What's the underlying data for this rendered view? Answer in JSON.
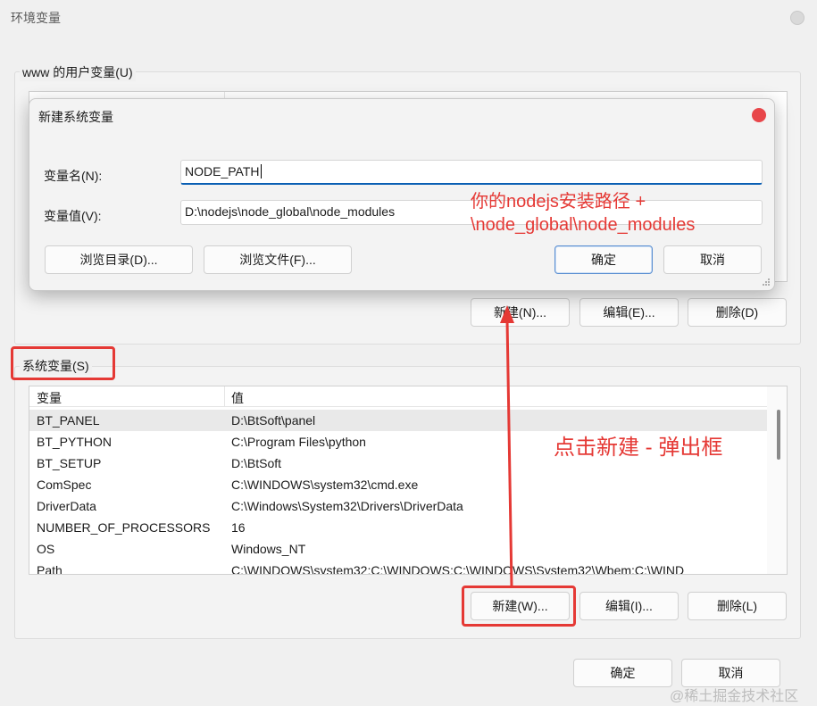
{
  "window": {
    "title": "环境变量",
    "ok_label": "确定",
    "cancel_label": "取消"
  },
  "user_vars": {
    "group_label": "www 的用户变量(U)",
    "new_label": "新建(N)...",
    "edit_label": "编辑(E)...",
    "delete_label": "删除(D)"
  },
  "dialog": {
    "title": "新建系统变量",
    "name_label": "变量名(N):",
    "name_value": "NODE_PATH",
    "value_label": "变量值(V):",
    "value_value": "D:\\nodejs\\node_global\\node_modules",
    "browse_dir_label": "浏览目录(D)...",
    "browse_file_label": "浏览文件(F)...",
    "ok_label": "确定",
    "cancel_label": "取消"
  },
  "system_vars": {
    "group_label": "系统变量(S)",
    "columns": [
      "变量",
      "值"
    ],
    "rows": [
      {
        "name": "BT_PANEL",
        "value": "D:\\BtSoft\\panel"
      },
      {
        "name": "BT_PYTHON",
        "value": "C:\\Program Files\\python"
      },
      {
        "name": "BT_SETUP",
        "value": "D:\\BtSoft"
      },
      {
        "name": "ComSpec",
        "value": "C:\\WINDOWS\\system32\\cmd.exe"
      },
      {
        "name": "DriverData",
        "value": "C:\\Windows\\System32\\Drivers\\DriverData"
      },
      {
        "name": "NUMBER_OF_PROCESSORS",
        "value": "16"
      },
      {
        "name": "OS",
        "value": "Windows_NT"
      },
      {
        "name": "Path",
        "value": "C:\\WINDOWS\\system32;C:\\WINDOWS;C:\\WINDOWS\\System32\\Wbem;C:\\WIND"
      }
    ],
    "new_label": "新建(W)...",
    "edit_label": "编辑(I)...",
    "delete_label": "删除(L)"
  },
  "annotations": {
    "path_hint_line1": "你的nodejs安装路径 +",
    "path_hint_line2": "\\node_global\\node_modules",
    "click_hint": "点击新建 - 弹出框",
    "color": "#e53935"
  },
  "watermark": "@稀土掘金技术社区"
}
